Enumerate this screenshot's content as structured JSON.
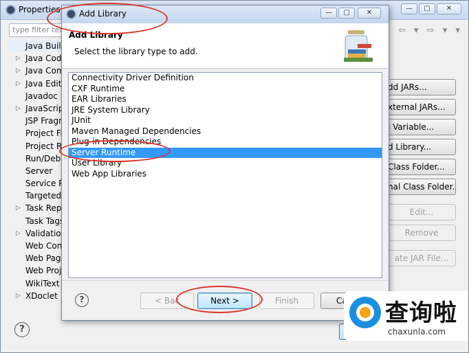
{
  "background_window": {
    "title": "Properties f",
    "filter_placeholder": "type filter tex",
    "tree_items": [
      {
        "label": "Java Build",
        "expandable": false,
        "selected": true
      },
      {
        "label": "Java Code",
        "expandable": true
      },
      {
        "label": "Java Comp",
        "expandable": true
      },
      {
        "label": "Java Editor",
        "expandable": true
      },
      {
        "label": "Javadoc Lo",
        "expandable": false
      },
      {
        "label": "JavaScript",
        "expandable": true
      },
      {
        "label": "JSP Fragm",
        "expandable": false
      },
      {
        "label": "Project Fa",
        "expandable": false
      },
      {
        "label": "Project Re",
        "expandable": false
      },
      {
        "label": "Run/Debu",
        "expandable": false
      },
      {
        "label": "Server",
        "expandable": false
      },
      {
        "label": "Service Po",
        "expandable": false
      },
      {
        "label": "Targeted",
        "expandable": false
      },
      {
        "label": "Task Repo",
        "expandable": true
      },
      {
        "label": "Task Tags",
        "expandable": false
      },
      {
        "label": "Validation",
        "expandable": true
      },
      {
        "label": "Web Cont",
        "expandable": false
      },
      {
        "label": "Web Page",
        "expandable": false
      },
      {
        "label": "Web Proje",
        "expandable": false
      },
      {
        "label": "WikiText",
        "expandable": false
      },
      {
        "label": "XDoclet",
        "expandable": true
      }
    ],
    "side_buttons": [
      {
        "label": "dd JARs...",
        "enabled": true
      },
      {
        "label": "xternal JARs...",
        "enabled": true
      },
      {
        "label": "l Variable...",
        "enabled": true
      },
      {
        "label": "d Library...",
        "enabled": true
      },
      {
        "label": "Class Folder...",
        "enabled": true
      },
      {
        "label": "nal Class Folder...",
        "enabled": true
      },
      {
        "label": "Edit...",
        "enabled": false
      },
      {
        "label": "Remove",
        "enabled": false
      },
      {
        "label": "ate JAR File...",
        "enabled": false
      }
    ],
    "help_glyph": "?"
  },
  "dialog": {
    "title": "Add Library",
    "header_title": "Add Library",
    "header_subtitle": "Select the library type to add.",
    "library_types": [
      "Connectivity Driver Definition",
      "CXF Runtime",
      "EAR Libraries",
      "JRE System Library",
      "JUnit",
      "Maven Managed Dependencies",
      "Plug-in Dependencies",
      "Server Runtime",
      "User Library",
      "Web App Libraries"
    ],
    "selected_library": "Server Runtime",
    "buttons": {
      "back": "< Bac",
      "next": "Next >",
      "finish": "Finish",
      "cancel": "Ca"
    },
    "help_glyph": "?"
  },
  "window_controls": {
    "minimize": "—",
    "maximize": "▢",
    "close": "✕"
  },
  "watermark": {
    "text": "查询啦",
    "url": "chaxunla.com"
  },
  "colors": {
    "selection": "#3399ff",
    "annotation": "#d9342b"
  }
}
